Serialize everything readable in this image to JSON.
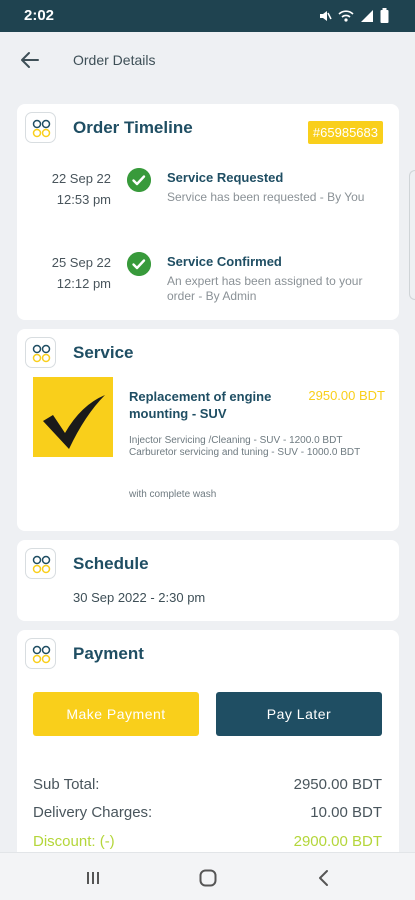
{
  "status_bar": {
    "time": "2:02",
    "icons": [
      "mute-icon",
      "wifi-icon",
      "signal-icon",
      "battery-icon"
    ]
  },
  "app_bar": {
    "title": "Order Details",
    "back_icon": "arrow-left-icon"
  },
  "timeline": {
    "title": "Order Timeline",
    "order_id": "#65985683",
    "events": [
      {
        "date": "22 Sep 22",
        "time": "12:53 pm",
        "title": "Service Requested",
        "desc": "Service has been requested - By You"
      },
      {
        "date": "25 Sep 22",
        "time": "12:12 pm",
        "title": "Service Confirmed",
        "desc": "An expert has been assigned to your order - By Admin"
      }
    ]
  },
  "service": {
    "title": "Service",
    "name": "Replacement of engine mounting - SUV",
    "price": "2950.00 BDT",
    "items": [
      "Injector Servicing /Cleaning - SUV - 1200.0 BDT",
      "Carburetor servicing and tuning  - SUV - 1000.0 BDT"
    ],
    "note": "with complete wash"
  },
  "schedule": {
    "title": "Schedule",
    "datetime": "30 Sep 2022 - 2:30 pm"
  },
  "payment": {
    "title": "Payment",
    "make_payment_label": "Make Payment",
    "pay_later_label": "Pay Later",
    "subtotal_label": "Sub Total:",
    "subtotal_value": "2950.00 BDT",
    "delivery_label": "Delivery Charges:",
    "delivery_value": "10.00 BDT",
    "discount_label": "Discount: (-)",
    "discount_value": "2900.00 BDT"
  },
  "colors": {
    "brand_dark": "#1f4e63",
    "accent_yellow": "#f9cf1b",
    "success_green": "#389a3b",
    "discount_green": "#b4d63a"
  }
}
